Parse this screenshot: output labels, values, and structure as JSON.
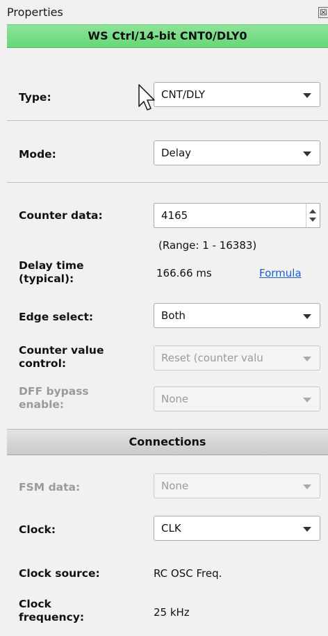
{
  "window": {
    "title": "Properties",
    "close_glyph": "☒"
  },
  "block": {
    "title": "WS Ctrl/14-bit CNT0/DLY0",
    "header_color": "#70d97f"
  },
  "type": {
    "label": "Type:",
    "value": "CNT/DLY"
  },
  "mode": {
    "label": "Mode:",
    "value": "Delay"
  },
  "counter_data": {
    "label": "Counter data:",
    "value": "4165",
    "range": "(Range:  1 - 16383)"
  },
  "delay_time": {
    "label_line1": "Delay time",
    "label_line2": "(typical):",
    "value": "166.66 ms",
    "formula_link": "Formula"
  },
  "edge_select": {
    "label": "Edge select:",
    "value": "Both"
  },
  "counter_value_control": {
    "label_line1": "Counter value",
    "label_line2": "control:",
    "value": "Reset (counter valu"
  },
  "dff_bypass": {
    "label_line1": "DFF bypass",
    "label_line2": "enable:",
    "value": "None"
  },
  "connections": {
    "title": "Connections"
  },
  "fsm_data": {
    "label": "FSM data:",
    "value": "None"
  },
  "clock": {
    "label": "Clock:",
    "value": "CLK"
  },
  "clock_source": {
    "label": "Clock source:",
    "value": "RC OSC Freq."
  },
  "clock_frequency": {
    "label_line1": "Clock",
    "label_line2": "frequency:",
    "value": "25 kHz"
  },
  "cursor": {
    "icon": "mouse-pointer-icon"
  }
}
